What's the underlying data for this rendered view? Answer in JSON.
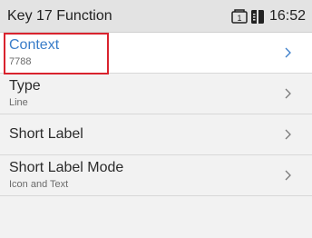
{
  "statusbar": {
    "title": "Key 17 Function",
    "time": "16:52",
    "line_badge": "1",
    "icons": [
      "line-icon",
      "phonebook-icon"
    ]
  },
  "list": {
    "items": [
      {
        "label": "Context",
        "sub": "7788",
        "selected": true
      },
      {
        "label": "Type",
        "sub": "Line",
        "selected": false
      },
      {
        "label": "Short Label",
        "sub": "",
        "selected": false
      },
      {
        "label": "Short Label Mode",
        "sub": "Icon and Text",
        "selected": false
      }
    ]
  },
  "colors": {
    "selected_text": "#3a7dc9",
    "highlight_box": "#d9232e",
    "background": "#f2f2f2",
    "statusbar": "#e3e3e3"
  }
}
